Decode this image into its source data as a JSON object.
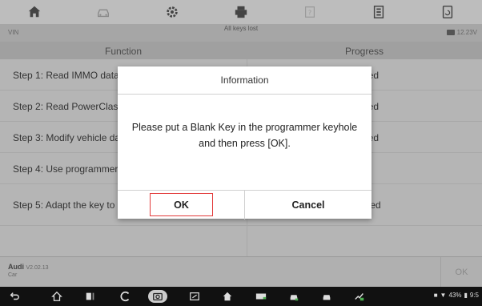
{
  "toolbar": {
    "buttons": [
      {
        "name": "home-icon"
      },
      {
        "name": "vehicle-swap-icon"
      },
      {
        "name": "settings-icon"
      },
      {
        "name": "print-icon"
      },
      {
        "name": "help-icon"
      },
      {
        "name": "save-icon"
      },
      {
        "name": "datalogging-icon"
      }
    ]
  },
  "infobar": {
    "vin_label": "VIN",
    "title": "All keys lost",
    "voltage": "12.23V"
  },
  "table": {
    "headers": {
      "function": "Function",
      "progress": "Progress"
    },
    "rows": [
      {
        "function": "Step 1: Read IMMO data",
        "progress": "Completed"
      },
      {
        "function": "Step 2: Read PowerClass",
        "progress": "Completed"
      },
      {
        "function": "Step 3: Modify vehicle data",
        "progress": "Completed"
      },
      {
        "function": "Step 4: Use programmer",
        "progress": ""
      },
      {
        "function": "Step 5: Adapt the key to immobilizer system.",
        "progress": "Not Started"
      }
    ]
  },
  "appbar": {
    "make": "Audi",
    "version": "V2.02.13",
    "sub": "Car",
    "ok_label": "OK"
  },
  "dialog": {
    "title": "Information",
    "message": "Please put a Blank Key in the programmer keyhole and then press [OK].",
    "ok_label": "OK",
    "cancel_label": "Cancel"
  },
  "statusbar": {
    "battery": "43%",
    "time": "9:5"
  },
  "colors": {
    "accent_border": "#e23a3a"
  }
}
